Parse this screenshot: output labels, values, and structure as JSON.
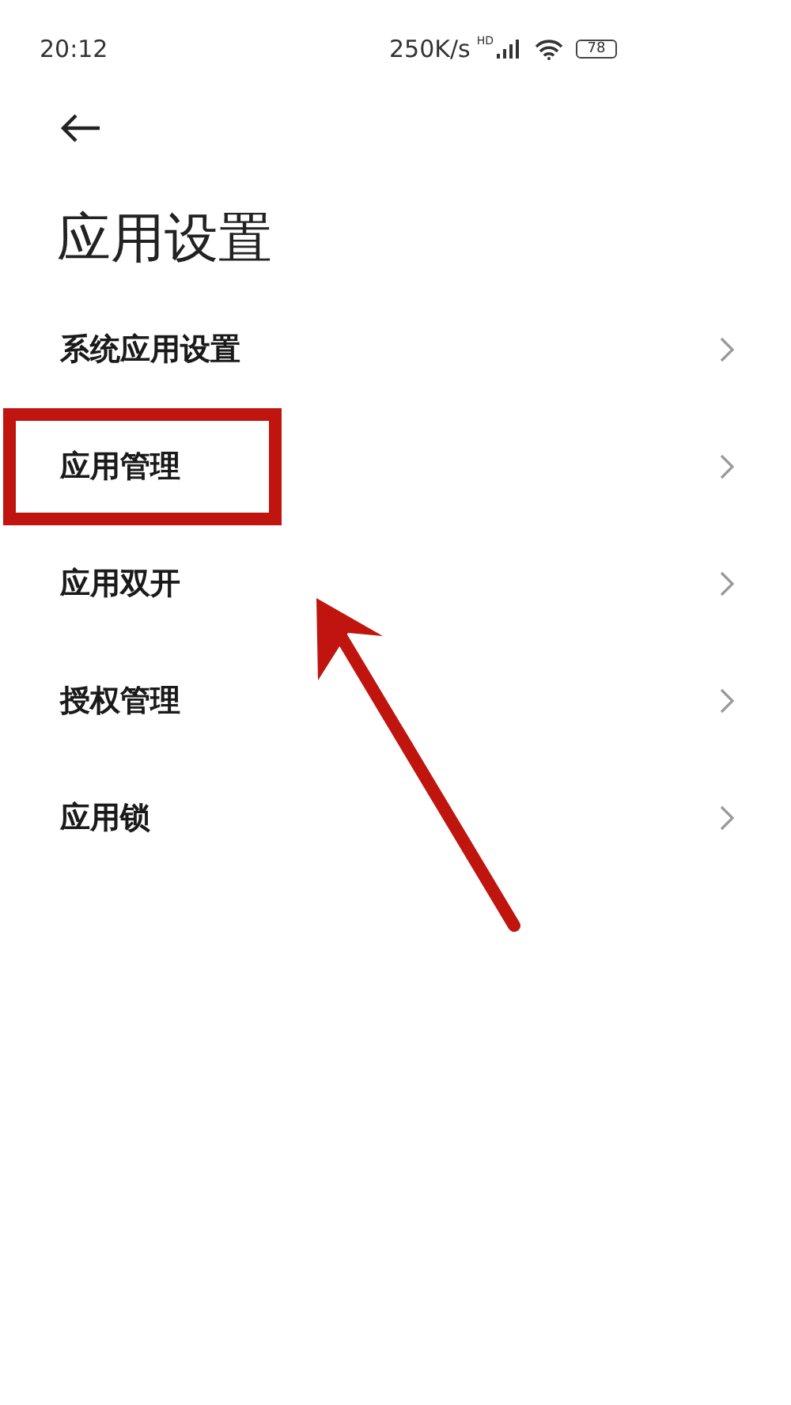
{
  "status_bar": {
    "time": "20:12",
    "speed": "250K/s",
    "network_badge": "HD",
    "battery": "78"
  },
  "header": {
    "title": "应用设置"
  },
  "items": [
    {
      "label": "系统应用设置",
      "highlighted": false
    },
    {
      "label": "应用管理",
      "highlighted": true
    },
    {
      "label": "应用双开",
      "highlighted": false
    },
    {
      "label": "授权管理",
      "highlighted": false
    },
    {
      "label": "应用锁",
      "highlighted": false
    }
  ]
}
